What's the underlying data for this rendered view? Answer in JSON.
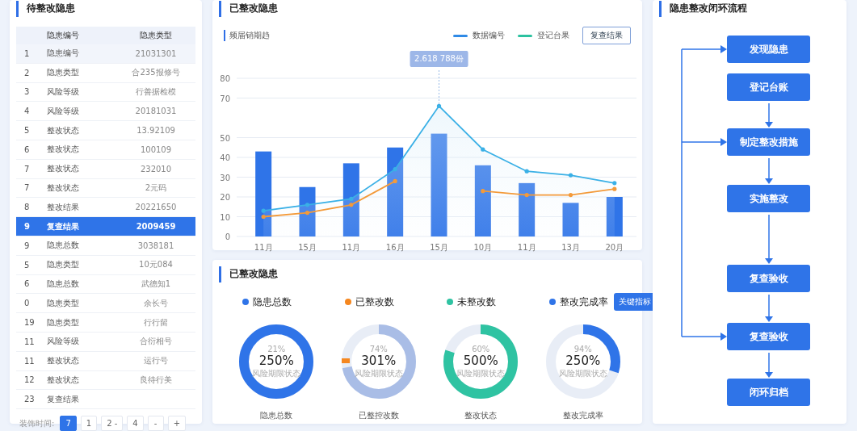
{
  "pending_panel": {
    "title": "待整改隐患",
    "columns": [
      "隐患编号",
      "隐患类型"
    ],
    "rows": [
      {
        "index": "1",
        "name": "隐患编号",
        "value": "21031301",
        "selected": false
      },
      {
        "index": "2",
        "name": "隐患类型",
        "value": "合235报修号",
        "selected": false
      },
      {
        "index": "3",
        "name": "风险等级",
        "value": "行善据检模",
        "selected": false
      },
      {
        "index": "4",
        "name": "风险等级",
        "value": "20181031",
        "selected": false
      },
      {
        "index": "5",
        "name": "整改状态",
        "value": "13.92109",
        "selected": false
      },
      {
        "index": "6",
        "name": "整改状态",
        "value": "100109",
        "selected": false
      },
      {
        "index": "7",
        "name": "整改状态",
        "value": "232010",
        "selected": false
      },
      {
        "index": "7",
        "name": "整改状态",
        "value": "2元码",
        "selected": false
      },
      {
        "index": "8",
        "name": "整改结果",
        "value": "20221650",
        "selected": false
      },
      {
        "index": "9",
        "name": "复查结果",
        "value": "2009459",
        "selected": true
      },
      {
        "index": "9",
        "name": "隐患总数",
        "value": "3038181",
        "selected": false
      },
      {
        "index": "5",
        "name": "隐患类型",
        "value": "10元084",
        "selected": false
      },
      {
        "index": "6",
        "name": "隐患总数",
        "value": "武德知1",
        "selected": false
      },
      {
        "index": "0",
        "name": "隐患类型",
        "value": "余长号",
        "selected": false
      },
      {
        "index": "19",
        "name": "隐患类型",
        "value": "行行留",
        "selected": false
      },
      {
        "index": "11",
        "name": "风险等级",
        "value": "合衍相号",
        "selected": false
      },
      {
        "index": "11",
        "name": "整改状态",
        "value": "运行号",
        "selected": false
      },
      {
        "index": "12",
        "name": "整改状态",
        "value": "良待行美",
        "selected": false
      },
      {
        "index": "23",
        "name": "复查结果",
        "selected": false
      }
    ],
    "pagination": {
      "label": "装饰时间:",
      "pages": [
        {
          "label": "7",
          "selected": true
        },
        {
          "label": "1",
          "selected": false
        },
        {
          "label": "2  -",
          "selected": false
        },
        {
          "label": "4",
          "selected": false
        },
        {
          "label": "-",
          "selected": false
        },
        {
          "label": "+",
          "selected": false
        }
      ]
    }
  },
  "trend_panel": {
    "title": "已整改隐患",
    "subtitle": "频届销期趋",
    "legend": [
      {
        "color": "#2f8ae6"
      },
      {
        "color": "#2cc2a0"
      }
    ],
    "button": "复查结果",
    "chart_data": {
      "type": "bar",
      "categories": [
        "11月",
        "15月",
        "11月",
        "16月",
        "15月",
        "10月",
        "11月",
        "13月",
        "20月"
      ],
      "values": [
        43,
        25,
        37,
        45,
        52,
        36,
        27,
        17,
        20
      ],
      "series": [
        {
          "name": "数据编号",
          "type": "area",
          "color": "#3ab0e6",
          "values": [
            13,
            16,
            19,
            34,
            66,
            44,
            33,
            31,
            27
          ]
        },
        {
          "name": "登记台果",
          "type": "line",
          "color": "#f39a3a",
          "values": [
            10,
            12,
            16,
            28,
            null,
            23,
            21,
            21,
            24
          ]
        }
      ],
      "ylim": [
        0,
        80
      ],
      "yticks": [
        0,
        10,
        20,
        30,
        40,
        50,
        70,
        80
      ],
      "grid": true,
      "annotations": [
        {
          "text": "2.618 788份"
        }
      ]
    }
  },
  "summary_panel": {
    "title": "已整改隐患",
    "button": "关键指标",
    "metrics": [
      {
        "label": "隐患总数",
        "color": "#2f74e8",
        "percent": "21%",
        "value": "250%",
        "caption": "风险期限状态",
        "footer": "隐患总数",
        "level": 1,
        "tick": false
      },
      {
        "label": "已整改数",
        "color": "#f5871f",
        "percent": "74%",
        "value": "301%",
        "caption": "风险期限状态",
        "footer": "已整控改数",
        "level": 0.72,
        "tick": true
      },
      {
        "label": "未整改数",
        "color": "#2fc3a2",
        "percent": "60%",
        "value": "500%",
        "caption": "风险期限状态",
        "footer": "整改状态",
        "level": 0.8,
        "tick": false
      },
      {
        "label": "整改完成率",
        "color": "#2f74e8",
        "percent": "94%",
        "value": "250%",
        "caption": "风险期限状态",
        "footer": "整改完成率",
        "level": 0.3,
        "tick": false
      }
    ]
  },
  "flow_panel": {
    "title": "隐患整改闭环流程",
    "nodes": [
      {
        "label": "发现隐患",
        "arrow_in": false,
        "loop_target": true
      },
      {
        "label": "登记台账",
        "arrow_in": false,
        "loop_target": false
      },
      {
        "label": "制定整改措施",
        "arrow_in": true,
        "loop_target": true
      },
      {
        "label": "实施整改",
        "arrow_in": true,
        "loop_target": false
      },
      {
        "label": "复查验收",
        "arrow_in": true,
        "loop_target": false
      },
      {
        "label": "复查验收",
        "arrow_in": true,
        "loop_target": true
      },
      {
        "label": "闭环归档",
        "arrow_in": true,
        "loop_target": false
      }
    ]
  }
}
